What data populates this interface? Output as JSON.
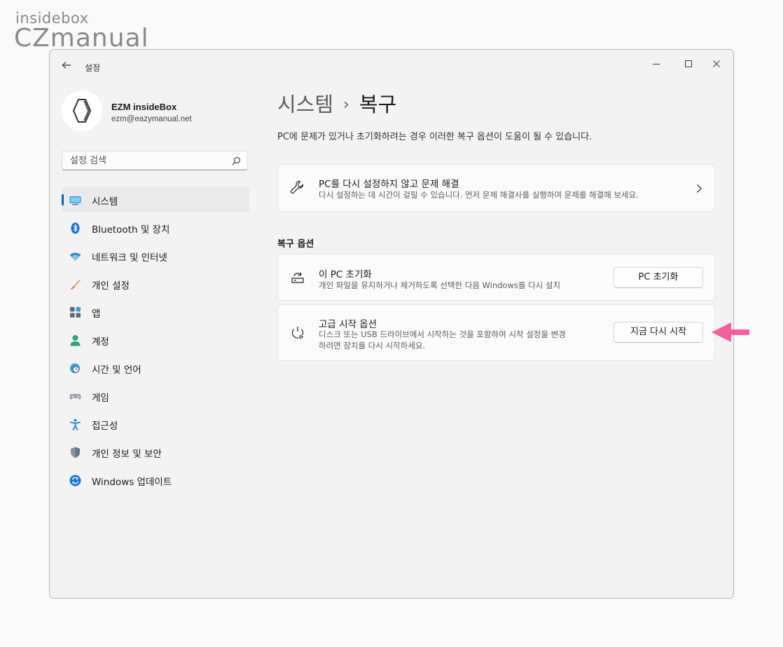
{
  "watermark": {
    "line1": "insidebox",
    "line2": "CZmanual"
  },
  "window": {
    "app_title": "설정"
  },
  "profile": {
    "name": "EZM insideBox",
    "email": "ezm@eazymanual.net"
  },
  "search": {
    "placeholder": "설정 검색"
  },
  "sidebar": {
    "items": [
      {
        "label": "시스템",
        "icon": "monitor-icon",
        "active": true
      },
      {
        "label": "Bluetooth 및 장치",
        "icon": "bluetooth-icon"
      },
      {
        "label": "네트워크 및 인터넷",
        "icon": "wifi-icon"
      },
      {
        "label": "개인 설정",
        "icon": "brush-icon"
      },
      {
        "label": "앱",
        "icon": "apps-icon"
      },
      {
        "label": "계정",
        "icon": "account-icon"
      },
      {
        "label": "시간 및 언어",
        "icon": "globe-clock-icon"
      },
      {
        "label": "게임",
        "icon": "gamepad-icon"
      },
      {
        "label": "접근성",
        "icon": "accessibility-icon"
      },
      {
        "label": "개인 정보 및 보안",
        "icon": "shield-icon"
      },
      {
        "label": "Windows 업데이트",
        "icon": "update-icon"
      }
    ]
  },
  "main": {
    "breadcrumb_parent": "시스템",
    "breadcrumb_sep": "›",
    "breadcrumb_current": "복구",
    "description": "PC에 문제가 있거나 초기화하려는 경우 이러한 복구 옵션이 도움이 될 수 있습니다.",
    "troubleshoot": {
      "title": "PC를 다시 설정하지 않고 문제 해결",
      "subtitle": "다시 설정하는 데 시간이 걸릴 수 있습니다. 먼저 문제 해결사를 실행하여 문제를 해결해 보세요."
    },
    "section_title": "복구 옵션",
    "reset": {
      "title": "이 PC 초기화",
      "subtitle": "개인 파일을 유지하거나 제거하도록 선택한 다음 Windows를 다시 설치",
      "button": "PC 초기화"
    },
    "advanced": {
      "title": "고급 시작 옵션",
      "subtitle_line1": "디스크 또는 USB 드라이브에서 시작하는 것을 포함하여 시작 설정을 변경",
      "subtitle_line2": "하려면 장치를 다시 시작하세요.",
      "button": "지금 다시 시작"
    }
  },
  "colors": {
    "accent": "#0067c0",
    "annotation_arrow": "#f2609a"
  }
}
